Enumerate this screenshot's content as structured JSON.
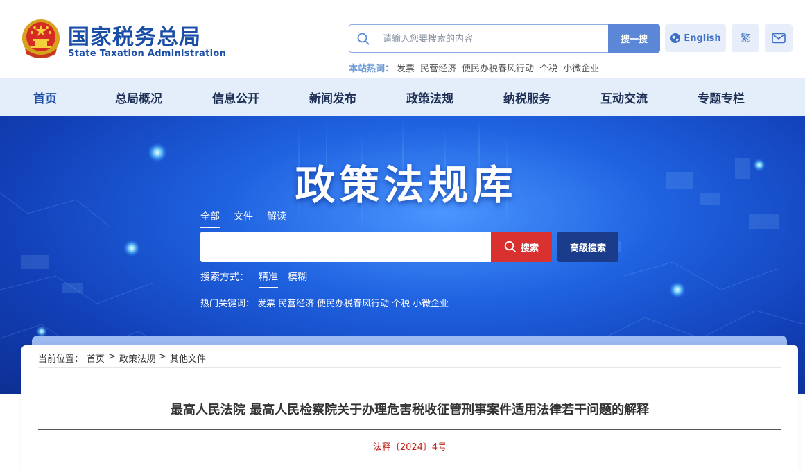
{
  "header": {
    "logo_cn": "国家税务总局",
    "logo_en": "State Taxation Administration",
    "search_placeholder": "请输入您要搜索的内容",
    "search_button": "搜一搜",
    "english_button": "English",
    "traditional_button": "繁",
    "hot_label": "本站热词：",
    "hot_words": [
      "发票",
      "民营经济",
      "便民办税春风行动",
      "个税",
      "小微企业"
    ]
  },
  "nav": {
    "items": [
      "首页",
      "总局概况",
      "信息公开",
      "新闻发布",
      "政策法规",
      "纳税服务",
      "互动交流",
      "专题专栏"
    ]
  },
  "banner": {
    "title": "政策法规库",
    "tabs": [
      "全部",
      "文件",
      "解读"
    ],
    "active_tab": "全部",
    "search_button": "搜索",
    "advanced_button": "高级搜索",
    "mode_label": "搜索方式：",
    "modes": [
      "精准",
      "模糊"
    ],
    "active_mode": "精准",
    "hot_label": "热门关键词：",
    "hot_words": [
      "发票",
      "民营经济",
      "便民办税春风行动",
      "个税",
      "小微企业"
    ]
  },
  "content": {
    "breadcrumb_label": "当前位置：",
    "breadcrumb": [
      "首页",
      "政策法规",
      "其他文件"
    ],
    "breadcrumb_sep": ">",
    "title": "最高人民法院 最高人民检察院关于办理危害税收征管刑事案件适用法律若干问题的解释",
    "doc_number": "法释〔2024〕4号"
  },
  "colors": {
    "brand_blue": "#1b4ea7",
    "search_blue": "#5b87d6",
    "nav_bg": "#e4eefb",
    "search_red": "#d93030",
    "advanced_navy": "#1b3c8a",
    "doc_number_red": "#c0221b"
  }
}
